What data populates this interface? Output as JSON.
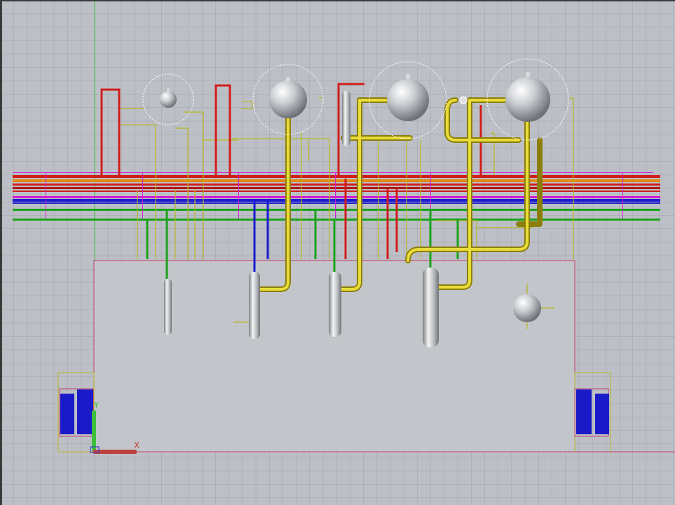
{
  "viewport": {
    "name": "cad-3d-viewport",
    "background_color": "#bcc0c6",
    "grid_color": "#9ea4aa",
    "major_grid_color": "#8e949a"
  },
  "colors": {
    "pipe_red": "#d21c1c",
    "pipe_dark_red": "#b01818",
    "pipe_orange": "#e08a1a",
    "pipe_yellow": "#d8c61a",
    "pipe_yellow_dark": "#8c7e0a",
    "pipe_blue": "#1a1ad0",
    "pipe_green": "#1aa21a",
    "pipe_magenta": "#d21ad2",
    "outline_magenta": "#c83c6a",
    "outline_yellow": "#b8b620",
    "vessel_light": "#f2f2f2",
    "vessel_mid": "#b4b8bc",
    "vessel_dark": "#6e7276",
    "equipment_blue": "#1a1ac8"
  },
  "ucs": {
    "x_axis_label": "X",
    "y_axis_label": "Y",
    "x_axis_color": "#c04040",
    "y_axis_color": "#3cbf3c",
    "z_axis_color": "#4040d0"
  },
  "icons": {
    "ucs": "ucs-axis-icon",
    "vessel_sphere": "spherical-vessel-icon",
    "vessel_column": "vertical-vessel-icon"
  }
}
